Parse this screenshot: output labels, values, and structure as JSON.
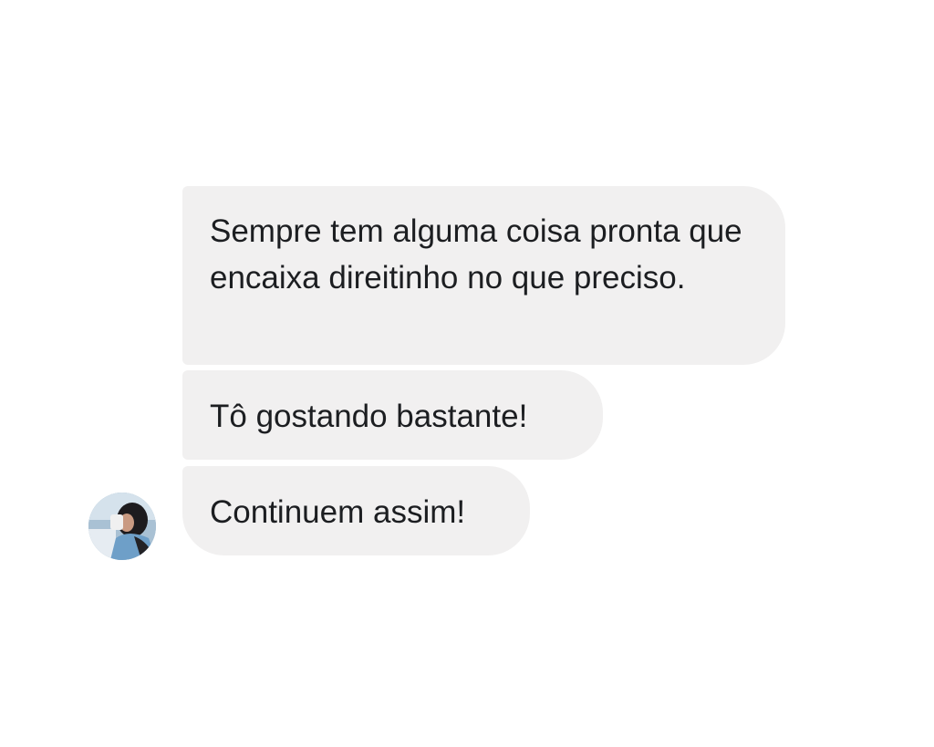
{
  "conversation": {
    "messages": [
      {
        "text": "Sempre tem alguma coisa pronta que encaixa direitinho no que preciso."
      },
      {
        "text": "Tô gostando bastante!"
      },
      {
        "text": "Continuem assim!"
      }
    ],
    "avatar": {
      "icon": "user-photo-avatar"
    }
  },
  "colors": {
    "background": "#ffffff",
    "bubble": "#f1f0f0",
    "text": "#1c1e21"
  }
}
